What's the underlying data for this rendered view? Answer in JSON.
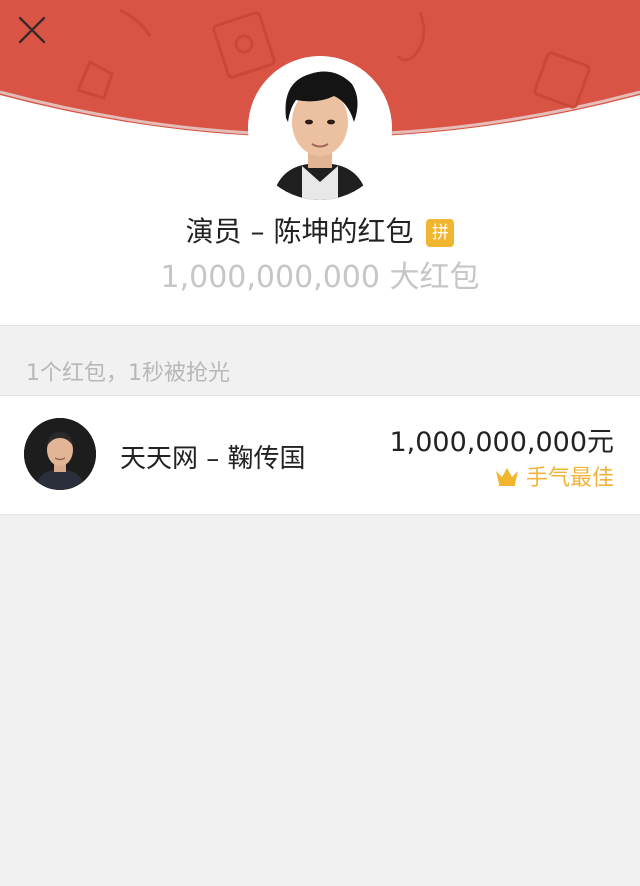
{
  "header": {
    "sender_title": "演员 – 陈坤的红包",
    "pin_badge": "拼",
    "amount_title": "1,000,000,000 大红包",
    "colors": {
      "arc": "#d95444",
      "pin_badge": "#f2b530"
    },
    "icons": {
      "close": "close-icon"
    }
  },
  "summary": "1个红包，1秒被抢光",
  "recipients": [
    {
      "name": "天天网 – 鞠传国",
      "amount": "1,000,000,000元",
      "badge": "手气最佳",
      "badge_icon": "crown-icon"
    }
  ]
}
